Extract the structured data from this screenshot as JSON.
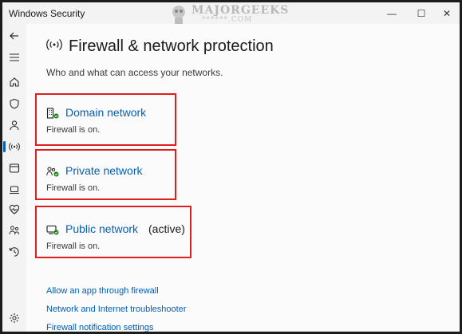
{
  "window": {
    "title": "Windows Security",
    "controls": {
      "minimize": "—",
      "maximize": "☐",
      "close": "✕"
    }
  },
  "watermark": {
    "text": "MAJORGEEKS",
    "sub": "******.COM"
  },
  "sidebar": {
    "items": [
      {
        "name": "back-icon",
        "selected": false
      },
      {
        "name": "menu-icon",
        "selected": false
      },
      {
        "name": "home-icon",
        "selected": false
      },
      {
        "name": "shield-icon",
        "selected": false
      },
      {
        "name": "person-icon",
        "selected": false
      },
      {
        "name": "wireless-icon",
        "selected": true
      },
      {
        "name": "app-browser-icon",
        "selected": false
      },
      {
        "name": "laptop-icon",
        "selected": false
      },
      {
        "name": "heart-icon",
        "selected": false
      },
      {
        "name": "family-icon",
        "selected": false
      },
      {
        "name": "history-icon",
        "selected": false
      },
      {
        "name": "settings-icon",
        "selected": false
      }
    ]
  },
  "page": {
    "title": "Firewall & network protection",
    "subtitle": "Who and what can access your networks."
  },
  "networks": [
    {
      "name": "Domain network",
      "active": "",
      "status": "Firewall is on.",
      "icon": "domain-network-icon"
    },
    {
      "name": "Private network",
      "active": "",
      "status": "Firewall is on.",
      "icon": "private-network-icon"
    },
    {
      "name": "Public network",
      "active": "(active)",
      "status": "Firewall is on.",
      "icon": "public-network-icon"
    }
  ],
  "links": [
    "Allow an app through firewall",
    "Network and Internet troubleshooter",
    "Firewall notification settings"
  ],
  "colors": {
    "accent": "#005fb8",
    "highlight": "#e02020",
    "check": "#107c10"
  }
}
